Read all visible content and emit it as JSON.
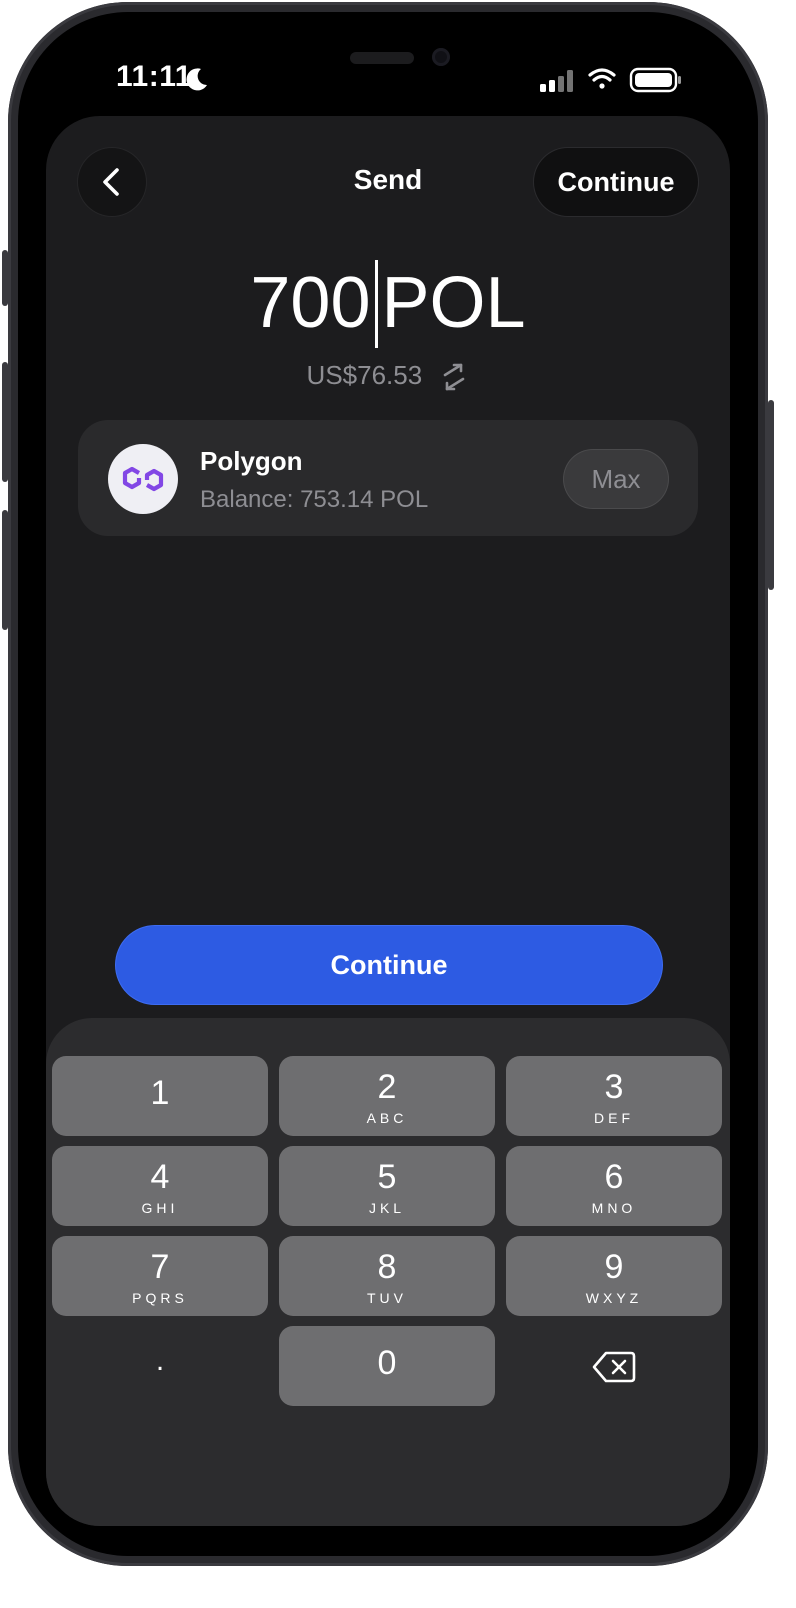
{
  "status_bar": {
    "time": "11:11"
  },
  "header": {
    "back_label": "",
    "title": "Send",
    "continue_label": "Continue"
  },
  "amount": {
    "value": "700",
    "unit": "POL",
    "fiat": "US$76.53"
  },
  "token": {
    "name": "Polygon",
    "balance": "Balance: 753.14 POL",
    "max_label": "Max",
    "logo_color": "#8247e5"
  },
  "primary_button": {
    "label": "Continue",
    "color": "#2d5be3"
  },
  "keypad": {
    "keys": [
      {
        "num": "1",
        "letters": ""
      },
      {
        "num": "2",
        "letters": "ABC"
      },
      {
        "num": "3",
        "letters": "DEF"
      },
      {
        "num": "4",
        "letters": "GHI"
      },
      {
        "num": "5",
        "letters": "JKL"
      },
      {
        "num": "6",
        "letters": "MNO"
      },
      {
        "num": "7",
        "letters": "PQRS"
      },
      {
        "num": "8",
        "letters": "TUV"
      },
      {
        "num": "9",
        "letters": "WXYZ"
      },
      {
        "num": ".",
        "letters": ""
      },
      {
        "num": "0",
        "letters": ""
      },
      {
        "num": "",
        "letters": "",
        "icon": "backspace-icon"
      }
    ]
  }
}
